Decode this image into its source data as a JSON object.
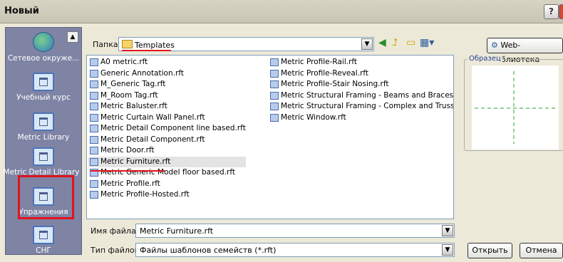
{
  "window": {
    "title": "Новый",
    "help_label": "?",
    "close_label": "x"
  },
  "places": [
    {
      "label": "Сетевое окруже...",
      "icon": "network-icon"
    },
    {
      "label": "Учебный курс",
      "icon": "folder-icon"
    },
    {
      "label": "Metric Library",
      "icon": "folder-icon"
    },
    {
      "label": "Metric Detail Library",
      "icon": "folder-icon"
    },
    {
      "label": "Упражнения",
      "icon": "folder-icon"
    },
    {
      "label": "СНГ",
      "icon": "folder-icon"
    }
  ],
  "folder": {
    "label": "Папка:",
    "value": "Templates"
  },
  "web_library_label": "Web-библиотека",
  "files_col1": [
    "A0 metric.rft",
    "Generic Annotation.rft",
    "M_Generic Tag.rft",
    "M_Room Tag.rft",
    "Metric Baluster.rft",
    "Metric Curtain Wall Panel.rft",
    "Metric Detail Component line based.rft",
    "Metric Detail Component.rft",
    "Metric Door.rft",
    "Metric Furniture.rft",
    "Metric Generic Model floor based.rft",
    "Metric Profile.rft",
    "Metric Profile-Hosted.rft"
  ],
  "files_col2": [
    "Metric Profile-Rail.rft",
    "Metric Profile-Reveal.rft",
    "Metric Profile-Stair Nosing.rft",
    "Metric Structural Framing - Beams and Braces.rft",
    "Metric Structural Framing - Complex and Trusses.rft",
    "Metric Window.rft"
  ],
  "selected_file": "Metric Furniture.rft",
  "preview_label": "Образец",
  "filename": {
    "label": "Имя файла:",
    "value": "Metric Furniture.rft"
  },
  "filetype": {
    "label": "Тип файлов:",
    "value": "Файлы шаблонов семейств (*.rft)"
  },
  "buttons": {
    "open": "Открыть",
    "cancel": "Отмена"
  },
  "colors": {
    "highlight_red": "#e1131d",
    "places_bg": "#7f84a5"
  }
}
